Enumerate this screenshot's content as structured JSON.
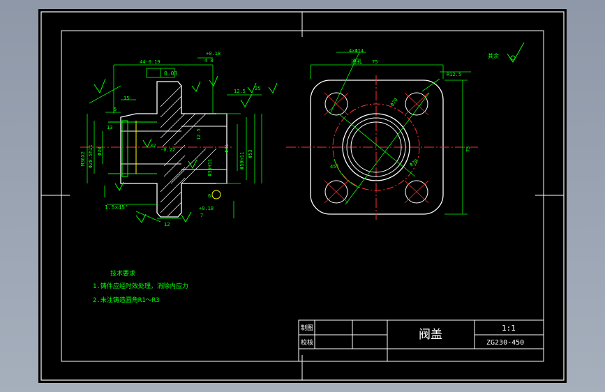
{
  "drawing": {
    "part_name": "阀盖",
    "scale": "1:1",
    "material": "ZG230-450",
    "title_block": {
      "drawn_label": "制图",
      "checked_label": "校核"
    },
    "tech_requirements": {
      "heading": "技术要求",
      "items": [
        "1.铸件应经时效处理，消除内应力",
        "2.未注铸造圆角R1～R3"
      ]
    },
    "roughness_note": "其余",
    "dimensions": {
      "top_len": "44-0.19",
      "top_tol": "+0.18",
      "top_eight": "4 8",
      "flatness": "0.03",
      "roughness_a": "12.5",
      "roughness_b": "25",
      "d15": "15",
      "d5": "5",
      "d13": "13",
      "m36": "M36X2",
      "d28": "Φ28.5h11",
      "d20": "Φ20",
      "d32": "32",
      "d22": "-0.22",
      "d35": "Φ35H11",
      "d41": "Φ41",
      "d50": "Φ50h11",
      "d53": "Φ53",
      "d125": "12.5",
      "chamfer": "1.5×45°",
      "d12": "12",
      "tol18b": "+0.18",
      "d7": "7",
      "d6": "6",
      "holes": "4×Φ14",
      "through": "通孔",
      "d75": "75",
      "r125": "R12.5",
      "dia70": "Φ70",
      "ang45": "45°",
      "d75v": "75"
    }
  }
}
